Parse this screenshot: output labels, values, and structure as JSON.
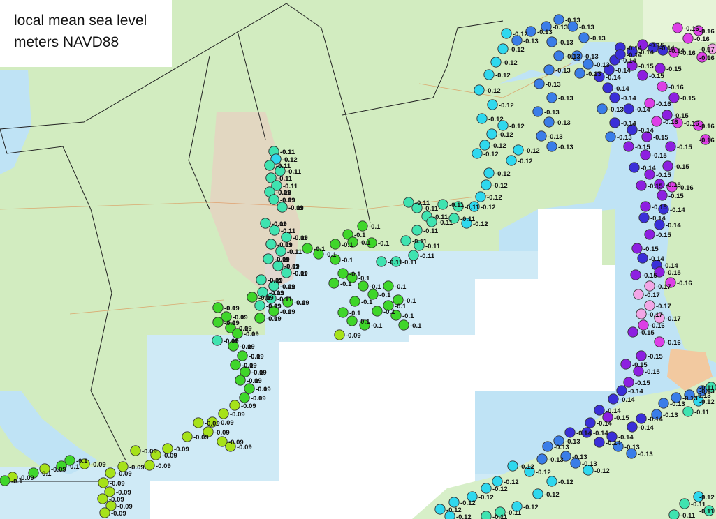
{
  "legend": {
    "title_line1": "local mean sea level",
    "title_line2": "meters NAVD88"
  },
  "colors": {
    "-0.09": "#a6e21a",
    "-0.1": "#3fd62a",
    "-0.11": "#3fe3b0",
    "-0.12": "#2fd8ee",
    "-0.13": "#3a7de8",
    "-0.14": "#3a2fd8",
    "-0.15": "#8d1fe0",
    "-0.16": "#dd3fe6",
    "-0.17": "#f2a6e6"
  },
  "stations": [
    {
      "value": "-0.1"
    },
    {
      "value": "-0.1"
    },
    {
      "value": "-0.1"
    },
    {
      "value": "-0.1"
    },
    {
      "value": "-0.1"
    },
    {
      "value": "-0.1"
    },
    {
      "value": "-0.09"
    },
    {
      "value": "-0.09"
    },
    {
      "value": "-0.09"
    },
    {
      "value": "-0.09"
    },
    {
      "value": "-0.1"
    },
    {
      "value": "-0.09"
    },
    {
      "value": "-0.09"
    },
    {
      "value": "-0.1"
    },
    {
      "value": "-0.09"
    },
    {
      "value": "-0.09"
    },
    {
      "value": "-0.09"
    },
    {
      "value": "-0.09"
    },
    {
      "value": "-0.09"
    },
    {
      "value": "-0.09"
    },
    {
      "value": "-0.1"
    },
    {
      "value": "-0.09"
    },
    {
      "value": "-0.09"
    },
    {
      "value": "-0.09"
    },
    {
      "value": "-0.09"
    },
    {
      "value": "-0.09"
    },
    {
      "value": "-0.09"
    },
    {
      "value": "-0.09"
    },
    {
      "value": "-0.09"
    },
    {
      "value": "-0.09"
    },
    {
      "value": "-0.09"
    },
    {
      "value": "-0.09"
    },
    {
      "value": "-0.09"
    },
    {
      "value": "-0.09"
    },
    {
      "value": "-0.09"
    },
    {
      "value": "-0.09"
    },
    {
      "value": "-0.09"
    },
    {
      "value": "-0.09"
    },
    {
      "value": "-0.09"
    },
    {
      "value": "-0.09"
    },
    {
      "value": "-0.09"
    },
    {
      "value": "-0.09"
    },
    {
      "value": "-0.09"
    },
    {
      "value": "-0.09"
    },
    {
      "value": "-0.09"
    },
    {
      "value": "-0.09"
    },
    {
      "value": "-0.09"
    },
    {
      "value": "-0.09"
    },
    {
      "value": "-0.09"
    },
    {
      "value": "-0.09"
    },
    {
      "value": "-0.09"
    },
    {
      "value": "-0.09"
    },
    {
      "value": "-0.09"
    },
    {
      "value": "-0.09"
    },
    {
      "value": "-0.09"
    },
    {
      "value": "-0.09"
    },
    {
      "value": "-0.09"
    },
    {
      "value": "-0.09"
    },
    {
      "value": "-0.09"
    },
    {
      "value": "-0.1"
    },
    {
      "value": "-0.1"
    },
    {
      "value": "-0.09"
    },
    {
      "value": "-0.1"
    },
    {
      "value": "-0.09"
    },
    {
      "value": "-0.1"
    },
    {
      "value": "-0.1"
    },
    {
      "value": "-0.1"
    },
    {
      "value": "-0.1"
    },
    {
      "value": "-0.1"
    },
    {
      "value": "-0.1"
    },
    {
      "value": "-0.1"
    },
    {
      "value": "-0.1"
    },
    {
      "value": "-0.1"
    },
    {
      "value": "-0.1"
    },
    {
      "value": "-0.1"
    },
    {
      "value": "-0.1"
    },
    {
      "value": "-0.1"
    },
    {
      "value": "-0.1"
    },
    {
      "value": "-0.1"
    },
    {
      "value": "-0.1"
    },
    {
      "value": "-0.09"
    },
    {
      "value": "-0.1"
    },
    {
      "value": "-0.1"
    },
    {
      "value": "-0.1"
    },
    {
      "value": "-0.1"
    },
    {
      "value": "-0.1"
    },
    {
      "value": "-0.1"
    },
    {
      "value": "-0.1"
    },
    {
      "value": "-0.1"
    },
    {
      "value": "-0.11"
    },
    {
      "value": "-0.11"
    },
    {
      "value": "-0.11"
    },
    {
      "value": "-0.11"
    },
    {
      "value": "-0.11"
    },
    {
      "value": "-0.11"
    },
    {
      "value": "-0.11"
    },
    {
      "value": "-0.11"
    },
    {
      "value": "-0.11"
    },
    {
      "value": "-0.11"
    },
    {
      "value": "-0.11"
    },
    {
      "value": "-0.11"
    },
    {
      "value": "-0.11"
    },
    {
      "value": "-0.12"
    },
    {
      "value": "-0.12"
    },
    {
      "value": "-0.12"
    },
    {
      "value": "-0.12"
    },
    {
      "value": "-0.12"
    },
    {
      "value": "-0.12"
    },
    {
      "value": "-0.12"
    },
    {
      "value": "-0.12"
    },
    {
      "value": "-0.12"
    },
    {
      "value": "-0.12"
    },
    {
      "value": "-0.12"
    },
    {
      "value": "-0.12"
    },
    {
      "value": "-0.12"
    },
    {
      "value": "-0.12"
    },
    {
      "value": "-0.12"
    },
    {
      "value": "-0.12"
    },
    {
      "value": "-0.12"
    },
    {
      "value": "-0.12"
    },
    {
      "value": "-0.13"
    },
    {
      "value": "-0.13"
    },
    {
      "value": "-0.13"
    },
    {
      "value": "-0.13"
    },
    {
      "value": "-0.13"
    },
    {
      "value": "-0.13"
    },
    {
      "value": "-0.13"
    },
    {
      "value": "-0.13"
    },
    {
      "value": "-0.13"
    },
    {
      "value": "-0.13"
    },
    {
      "value": "-0.13"
    },
    {
      "value": "-0.13"
    },
    {
      "value": "-0.13"
    },
    {
      "value": "-0.13"
    },
    {
      "value": "-0.13"
    },
    {
      "value": "-0.13"
    },
    {
      "value": "-0.13"
    },
    {
      "value": "-0.13"
    },
    {
      "value": "-0.14"
    },
    {
      "value": "-0.14"
    },
    {
      "value": "-0.14"
    },
    {
      "value": "-0.14"
    },
    {
      "value": "-0.14"
    },
    {
      "value": "-0.14"
    },
    {
      "value": "-0.13"
    },
    {
      "value": "-0.14"
    },
    {
      "value": "-0.14"
    },
    {
      "value": "-0.13"
    },
    {
      "value": "-0.14"
    },
    {
      "value": "-0.15"
    },
    {
      "value": "-0.15"
    },
    {
      "value": "-0.15"
    },
    {
      "value": "-0.14"
    },
    {
      "value": "-0.15"
    },
    {
      "value": "-0.15"
    },
    {
      "value": "-0.15"
    },
    {
      "value": "-0.15"
    },
    {
      "value": "-0.15"
    },
    {
      "value": "-0.14"
    },
    {
      "value": "-0.14"
    },
    {
      "value": "-0.14"
    },
    {
      "value": "-0.15"
    },
    {
      "value": "-0.15"
    },
    {
      "value": "-0.14"
    },
    {
      "value": "-0.14"
    },
    {
      "value": "-0.15"
    },
    {
      "value": "-0.14"
    },
    {
      "value": "-0.14"
    },
    {
      "value": "-0.15"
    },
    {
      "value": "-0.14"
    },
    {
      "value": "-0.14"
    },
    {
      "value": "-0.15"
    },
    {
      "value": "-0.15"
    },
    {
      "value": "-0.15"
    },
    {
      "value": "-0.16"
    },
    {
      "value": "-0.15"
    },
    {
      "value": "-0.16"
    },
    {
      "value": "-0.15"
    },
    {
      "value": "-0.16"
    },
    {
      "value": "-0.16"
    },
    {
      "value": "-0.15"
    },
    {
      "value": "-0.15"
    },
    {
      "value": "-0.16"
    },
    {
      "value": "-0.15"
    },
    {
      "value": "-0.16"
    },
    {
      "value": "-0.16"
    },
    {
      "value": "-0.16"
    },
    {
      "value": "-0.16"
    },
    {
      "value": "-0.16"
    },
    {
      "value": "-0.16"
    },
    {
      "value": "-0.16"
    },
    {
      "value": "-0.16"
    },
    {
      "value": "-0.17"
    },
    {
      "value": "-0.17"
    },
    {
      "value": "-0.17"
    },
    {
      "value": "-0.17"
    },
    {
      "value": "-0.17"
    },
    {
      "value": "-0.17"
    },
    {
      "value": "-0.16"
    },
    {
      "value": "-0.15"
    },
    {
      "value": "-0.16"
    },
    {
      "value": "-0.15"
    },
    {
      "value": "-0.15"
    },
    {
      "value": "-0.15"
    },
    {
      "value": "-0.15"
    },
    {
      "value": "-0.14"
    },
    {
      "value": "-0.14"
    },
    {
      "value": "-0.14"
    },
    {
      "value": "-0.15"
    },
    {
      "value": "-0.14"
    },
    {
      "value": "-0.14"
    },
    {
      "value": "-0.14"
    },
    {
      "value": "-0.14"
    },
    {
      "value": "-0.14"
    },
    {
      "value": "-0.14"
    },
    {
      "value": "-0.14"
    },
    {
      "value": "-0.13"
    },
    {
      "value": "-0.13"
    },
    {
      "value": "-0.13"
    },
    {
      "value": "-0.13"
    },
    {
      "value": "-0.13"
    },
    {
      "value": "-0.13"
    },
    {
      "value": "-0.13"
    },
    {
      "value": "-0.13"
    },
    {
      "value": "-0.13"
    },
    {
      "value": "-0.13"
    },
    {
      "value": "-0.13"
    },
    {
      "value": "-0.13"
    },
    {
      "value": "-0.12"
    },
    {
      "value": "-0.12"
    },
    {
      "value": "-0.12"
    },
    {
      "value": "-0.12"
    },
    {
      "value": "-0.12"
    },
    {
      "value": "-0.12"
    },
    {
      "value": "-0.12"
    },
    {
      "value": "-0.12"
    },
    {
      "value": "-0.12"
    },
    {
      "value": "-0.12"
    },
    {
      "value": "-0.12"
    },
    {
      "value": "-0.12"
    },
    {
      "value": "-0.11"
    },
    {
      "value": "-0.11"
    },
    {
      "value": "-0.11"
    },
    {
      "value": "-0.12"
    },
    {
      "value": "-0.11"
    },
    {
      "value": "-0.11"
    },
    {
      "value": "-0.11"
    },
    {
      "value": "-0.12"
    },
    {
      "value": "-0.11"
    },
    {
      "value": "-0.11"
    },
    {
      "value": "-0.12"
    },
    {
      "value": "-0.11"
    },
    {
      "value": "-0.11"
    },
    {
      "value": "-0.11"
    },
    {
      "value": "-0.11"
    },
    {
      "value": "-0.11"
    },
    {
      "value": "-0.11"
    },
    {
      "value": "-0.11"
    },
    {
      "value": "-0.11"
    },
    {
      "value": "-0.11"
    },
    {
      "value": "-0.11"
    },
    {
      "value": "-0.11"
    },
    {
      "value": "-0.11"
    },
    {
      "value": "-0.11"
    },
    {
      "value": "-0.11"
    },
    {
      "value": "-0.11"
    },
    {
      "value": "-0.11"
    },
    {
      "value": "-0.11"
    },
    {
      "value": "-0.11"
    },
    {
      "value": "-0.11"
    },
    {
      "value": "-0.1"
    },
    {
      "value": "-0.11"
    },
    {
      "value": "-0.1"
    },
    {
      "value": "-0.1"
    },
    {
      "value": "-0.1"
    },
    {
      "value": "-0.1"
    },
    {
      "value": "-0.1"
    },
    {
      "value": "-0.1"
    },
    {
      "value": "-0.1"
    },
    {
      "value": "-0.1"
    },
    {
      "value": "-0.11"
    },
    {
      "value": "-0.1"
    },
    {
      "value": "-0.1"
    },
    {
      "value": "-0.1"
    },
    {
      "value": "-0.1"
    },
    {
      "value": "-0.1"
    },
    {
      "value": "-0.1"
    },
    {
      "value": "-0.1"
    }
  ]
}
